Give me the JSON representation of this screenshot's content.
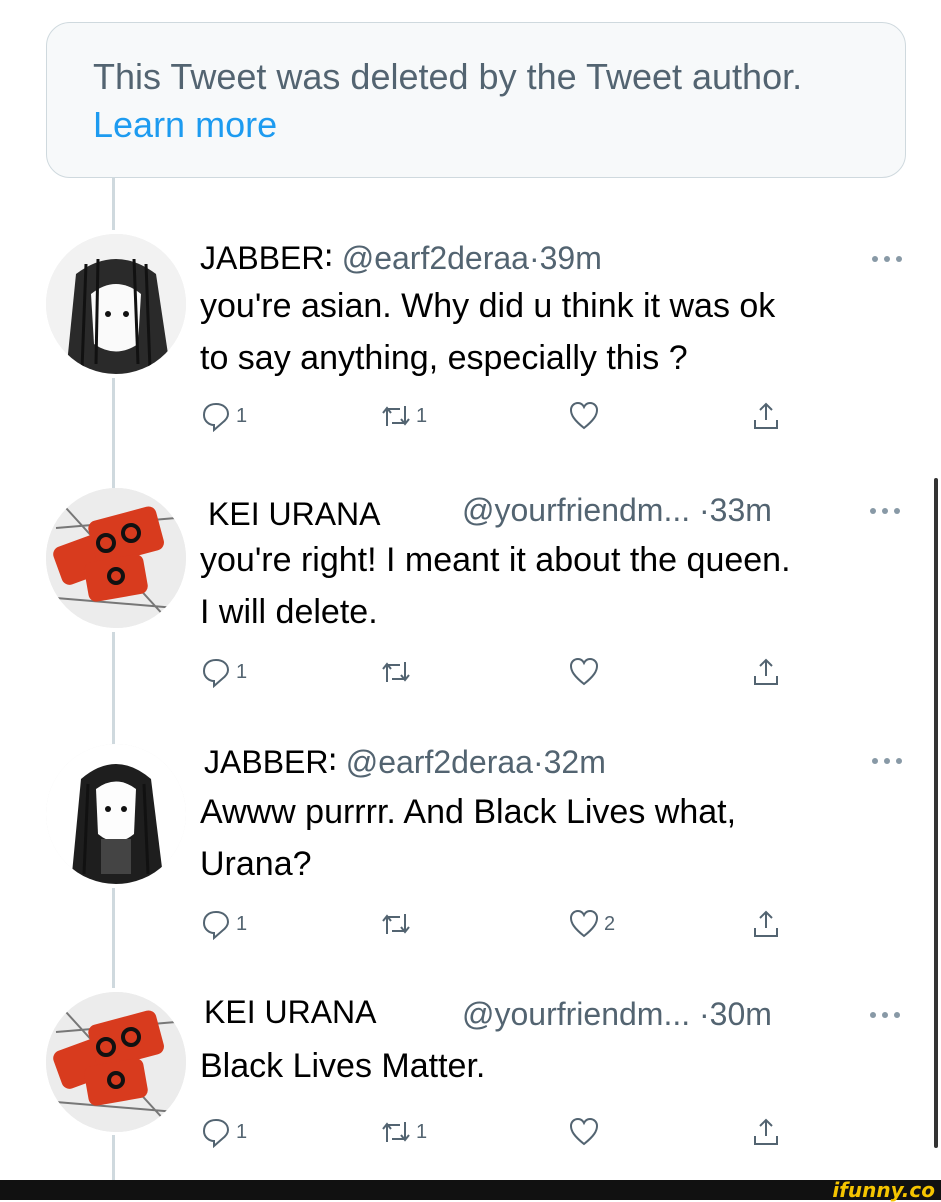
{
  "deleted_notice": {
    "text": "This Tweet was deleted by the Tweet author.",
    "link": "Learn more"
  },
  "tweets": [
    {
      "name": "JABBER∶",
      "handle": "@earf2deraa",
      "separator": "·",
      "time": "39m",
      "text": "you're asian. Why did u think it was ok\nto say anything, especially this ?",
      "reply_count": "1",
      "retweet_count": "1",
      "like_count": ""
    },
    {
      "name": "KEI URANA",
      "handle": "@yourfriendm...",
      "separator": "·",
      "time": "33m",
      "text": "you're right! I meant it about the queen.\nI will delete.",
      "reply_count": "1",
      "retweet_count": "",
      "like_count": ""
    },
    {
      "name": "JABBER∶",
      "handle": "@earf2deraa",
      "separator": "·",
      "time": "32m",
      "text": "Awww purrrr. And Black Lives what,\n Urana?",
      "reply_count": "1",
      "retweet_count": "",
      "like_count": "2"
    },
    {
      "name": "KEI URANA",
      "handle": "@yourfriendm...",
      "separator": "·",
      "time": "30m",
      "text": "Black Lives Matter.",
      "reply_count": "1",
      "retweet_count": "1",
      "like_count": ""
    }
  ],
  "icons": {
    "reply": "reply-icon",
    "retweet": "retweet-icon",
    "like": "heart-icon",
    "share": "share-icon",
    "more": "more-icon"
  },
  "colors": {
    "link": "#1d9bf0",
    "muted": "#536471",
    "border": "#cfd9de"
  },
  "watermark": "ifunny.co"
}
